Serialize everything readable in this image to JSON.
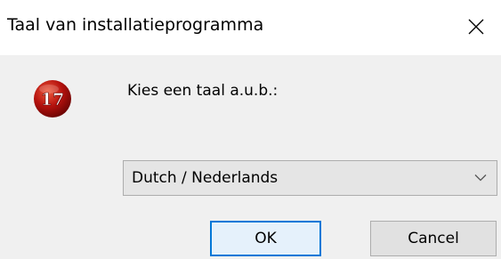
{
  "window": {
    "title": "Taal van installatieprogramma"
  },
  "icons": {
    "close": "close-icon",
    "logo": "app-logo-icon",
    "dropdown": "chevron-down-icon"
  },
  "logo": {
    "text": "17",
    "color": "#b5120e"
  },
  "prompt": {
    "label": "Kies een taal a.u.b.:"
  },
  "language_select": {
    "selected": "Dutch / Nederlands"
  },
  "buttons": {
    "ok_label": "OK",
    "cancel_label": "Cancel"
  },
  "colors": {
    "accent": "#0078d7",
    "dialog_background": "#f0f0f0",
    "titlebar_background": "#ffffff"
  }
}
